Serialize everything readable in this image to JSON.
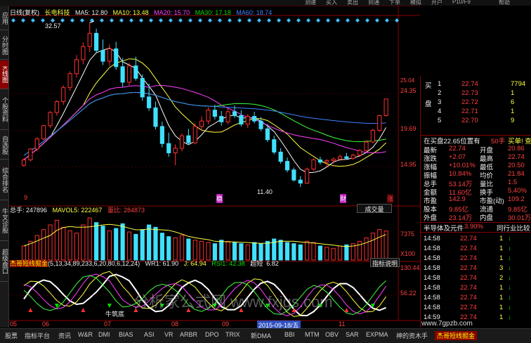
{
  "top_menu": [
    "帮助",
    "P10/F9",
    "开户",
    "模拟",
    "下单",
    "到通",
    "卖出",
    "买入",
    "测速"
  ],
  "side_tabs": [
    "应用",
    "分时图",
    "K线图",
    "个股资料",
    "自选股",
    "综合排名",
    "牛叉诊股",
    "超级盘口"
  ],
  "header": {
    "period": "日线(复权)",
    "stock_name": "长电科技",
    "ma5": "MA5: 12.80",
    "ma10": "MA10: 13.48",
    "ma20": "MA20: 15.70",
    "ma30": "MA30: 17.18",
    "ma60": "MA60: 18.74"
  },
  "price_labels": {
    "high_marker": "32.57",
    "low_marker": "11.40",
    "axis_top": "25.04",
    "axis_2": "24.35",
    "axis_3": "19.69",
    "axis_4": "14.95",
    "markers": [
      "9",
      "稳",
      "财",
      "涨"
    ]
  },
  "volume_header": {
    "vol": "总手: 247896",
    "mavol": "MAVOL5: 222467",
    "ratio": "量比: 284873",
    "button": "成交量"
  },
  "volume_axis": [
    "7375",
    "X100"
  ],
  "indicator_header": {
    "name": "杰哥短线掘金",
    "params": "(5,13,34,89,233,6,20,80,6,12,24)",
    "wr": "WR1: 61.90",
    "j": "J: 64.94",
    "rsi": "RSI1: 42.38",
    "super": "超短",
    "super_val": "6.82",
    "button": "指标说明"
  },
  "indicator_axis": [
    "130.44",
    "56.22"
  ],
  "x_axis": {
    "labels": [
      "05",
      "06",
      "07",
      "08",
      "09",
      "10",
      "11"
    ],
    "cursor_date": "2015-09-18/五"
  },
  "annotation": "牛筑底",
  "watermark_text": "分析家公式网 www.fxjgs.com",
  "bottom_tabs": [
    "股票",
    "指标平台",
    "资讯",
    "W&R",
    "DMI",
    "BIAS",
    "ASI",
    "VR",
    "ARBR",
    "DPO",
    "TRIX",
    "新DMA",
    "BBI",
    "MTM",
    "OBV",
    "SAR",
    "EXPMA",
    "神的资木手",
    "杰哥短线掘金"
  ],
  "footer_site": "www.7gpzb.com",
  "right_panel": {
    "order_rows": [
      {
        "side": "买",
        "level": "1",
        "price": "22.74",
        "vol": "7794"
      },
      {
        "side": "",
        "level": "2",
        "price": "22.73",
        "vol": "1"
      },
      {
        "side": "盘",
        "level": "3",
        "price": "22.72",
        "vol": "6"
      },
      {
        "side": "",
        "level": "4",
        "price": "22.71",
        "vol": "1"
      },
      {
        "side": "",
        "level": "5",
        "price": "22.70",
        "vol": "9"
      }
    ],
    "buy_note": "在买盘22.65位置有",
    "buy_note2": "50手",
    "buy_link": "买单! 查看详情",
    "quote_rows": [
      {
        "k1": "最新",
        "v1": "22.74",
        "k2": "开盘",
        "v2": "20.86"
      },
      {
        "k1": "涨跌",
        "v1": "+2.07",
        "k2": "最高",
        "v2": "22.74"
      },
      {
        "k1": "涨幅",
        "v1": "+10.01%",
        "k2": "最低",
        "v2": "20.50"
      },
      {
        "k1": "振幅",
        "v1": "10.84%",
        "k2": "均价",
        "v2": "21.84"
      },
      {
        "k1": "总手",
        "v1": "53.14万",
        "k2": "量比",
        "v2": "1.5"
      },
      {
        "k1": "金额",
        "v1": "11.60亿",
        "k2": "换手",
        "v2": "5.40%"
      },
      {
        "k1": "市盈",
        "v1": "142.9",
        "k2": "市盈(动)",
        "v2": "109.2"
      },
      {
        "k1": "股本",
        "v1": "9.85亿",
        "k2": "流通",
        "v2": "9.85亿"
      },
      {
        "k1": "外盘",
        "v1": "23.14万",
        "k2": "内盘",
        "v2": "30.01万"
      }
    ],
    "sector": "半导体及元件",
    "sector_pct": "3.90%",
    "compare": "同行业比较",
    "ticks": [
      {
        "t": "14:58",
        "p": "22.74",
        "v": "1"
      },
      {
        "t": "14:58",
        "p": "22.74",
        "v": "1"
      },
      {
        "t": "14:58",
        "p": "22.74",
        "v": "1"
      },
      {
        "t": "14:58",
        "p": "22.74",
        "v": "3"
      },
      {
        "t": "14:58",
        "p": "22.74",
        "v": "2"
      },
      {
        "t": "14:58",
        "p": "22.74",
        "v": "1"
      },
      {
        "t": "14:58",
        "p": "22.74",
        "v": "1"
      },
      {
        "t": "14:58",
        "p": "22.74",
        "v": "1"
      },
      {
        "t": "14:59",
        "p": "22.74",
        "v": "1"
      }
    ]
  },
  "colors": {
    "up": "#ff3030",
    "down": "#40e0ff",
    "ma5": "#ffffff",
    "ma10": "#ffff40",
    "ma20": "#ff40ff",
    "ma30": "#40ff40",
    "ma60": "#4080ff",
    "grid": "#8a0000"
  },
  "chart_data": {
    "type": "candlestick",
    "period": "日线(复权)",
    "categories_months": [
      "05",
      "06",
      "07",
      "08",
      "09",
      "10",
      "11"
    ],
    "ohlc": [
      [
        14.2,
        15.1,
        14.0,
        14.9
      ],
      [
        14.9,
        16.4,
        14.7,
        16.3
      ],
      [
        16.3,
        17.8,
        16.0,
        17.6
      ],
      [
        17.6,
        19.4,
        17.4,
        19.3
      ],
      [
        19.3,
        21.2,
        19.0,
        21.0
      ],
      [
        21.0,
        22.6,
        20.6,
        22.4
      ],
      [
        22.4,
        24.5,
        22.0,
        24.2
      ],
      [
        24.2,
        26.3,
        23.8,
        26.0
      ],
      [
        26.0,
        28.4,
        25.5,
        27.8
      ],
      [
        27.8,
        30.0,
        27.2,
        29.5
      ],
      [
        29.5,
        32.57,
        28.8,
        31.2
      ],
      [
        31.2,
        31.8,
        28.6,
        29.0
      ],
      [
        29.0,
        30.4,
        27.1,
        27.6
      ],
      [
        27.6,
        29.8,
        27.0,
        29.2
      ],
      [
        29.2,
        30.1,
        26.5,
        26.9
      ],
      [
        26.9,
        28.0,
        24.3,
        24.9
      ],
      [
        24.9,
        27.4,
        24.5,
        27.0
      ],
      [
        27.0,
        28.2,
        25.1,
        25.4
      ],
      [
        25.4,
        25.9,
        22.5,
        23.0
      ],
      [
        23.0,
        24.7,
        21.2,
        21.6
      ],
      [
        21.6,
        22.4,
        18.8,
        19.2
      ],
      [
        19.2,
        19.8,
        16.5,
        17.0
      ],
      [
        17.0,
        18.4,
        15.3,
        15.8
      ],
      [
        15.8,
        16.9,
        14.2,
        16.4
      ],
      [
        16.4,
        18.3,
        16.0,
        18.0
      ],
      [
        18.0,
        18.9,
        16.8,
        17.1
      ],
      [
        17.1,
        19.6,
        16.9,
        19.2
      ],
      [
        19.2,
        20.5,
        18.6,
        19.9
      ],
      [
        19.9,
        21.7,
        19.5,
        21.3
      ],
      [
        21.3,
        22.0,
        20.1,
        20.5
      ],
      [
        20.5,
        21.2,
        19.3,
        19.8
      ],
      [
        19.8,
        21.5,
        19.5,
        21.1
      ],
      [
        21.1,
        21.9,
        20.3,
        20.6
      ],
      [
        20.6,
        21.3,
        19.2,
        19.5
      ],
      [
        19.5,
        20.8,
        19.0,
        20.5
      ],
      [
        20.5,
        21.1,
        19.6,
        19.9
      ],
      [
        19.9,
        20.4,
        18.6,
        18.9
      ],
      [
        18.9,
        19.5,
        17.2,
        17.5
      ],
      [
        17.5,
        18.0,
        15.6,
        15.9
      ],
      [
        15.9,
        16.4,
        14.4,
        14.7
      ],
      [
        14.7,
        15.2,
        13.3,
        13.6
      ],
      [
        13.6,
        13.9,
        12.1,
        12.3
      ],
      [
        12.3,
        12.8,
        11.4,
        11.9
      ],
      [
        11.9,
        13.9,
        11.8,
        13.7
      ],
      [
        13.7,
        15.1,
        13.5,
        14.9
      ],
      [
        14.9,
        15.3,
        14.3,
        14.6
      ],
      [
        14.6,
        15.0,
        14.0,
        14.8
      ],
      [
        14.8,
        15.2,
        14.4,
        15.0
      ],
      [
        15.0,
        15.6,
        14.7,
        15.3
      ],
      [
        15.3,
        15.8,
        14.9,
        15.1
      ],
      [
        15.1,
        15.7,
        14.9,
        15.5
      ],
      [
        15.5,
        16.3,
        15.3,
        16.1
      ],
      [
        16.1,
        17.4,
        15.9,
        17.2
      ],
      [
        17.2,
        18.9,
        17.0,
        18.7
      ],
      [
        18.7,
        20.7,
        18.5,
        20.6
      ],
      [
        20.6,
        22.74,
        20.5,
        22.74
      ]
    ],
    "last": {
      "open": 20.86,
      "high": 22.74,
      "low": 20.5,
      "close": 22.74
    },
    "ma_values": {
      "MA5": 12.8,
      "MA10": 13.48,
      "MA20": 15.7,
      "MA30": 17.18,
      "MA60": 18.74
    },
    "price_axis": [
      25.04,
      24.35,
      19.69,
      14.95
    ],
    "high_mark": 32.57,
    "low_mark": 11.4,
    "volume": [
      120,
      160,
      210,
      260,
      300,
      340,
      280,
      250,
      230,
      300,
      360,
      320,
      290,
      250,
      270,
      310,
      240,
      220,
      260,
      300,
      280,
      230,
      200,
      190,
      210,
      180,
      170,
      160,
      150,
      140,
      170,
      160,
      150,
      140,
      130,
      150,
      140,
      160,
      180,
      170,
      150,
      140,
      130,
      160,
      150,
      120,
      110,
      100,
      120,
      130,
      140,
      160,
      190,
      230,
      260,
      247.896
    ],
    "volume_axis": [
      7375
    ],
    "vol_stats": {
      "vol": 247896,
      "mavol5": 222467,
      "ratio": 284873
    },
    "indicator": {
      "WR1": 61.9,
      "J": 64.94,
      "RSI1": 42.38,
      "super_short": 6.82,
      "axis": [
        130.44,
        56.22
      ]
    }
  }
}
